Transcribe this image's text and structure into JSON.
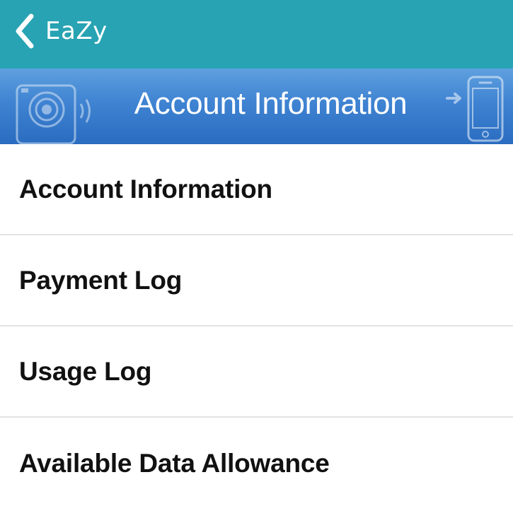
{
  "navbar": {
    "back_label": "EaZy",
    "background_color": "#27a3b3"
  },
  "banner": {
    "title": "Account Information",
    "left_icon": "camera-icon",
    "right_icon": "phone-transfer-icon"
  },
  "menu": {
    "items": [
      {
        "label": "Account Information"
      },
      {
        "label": "Payment Log"
      },
      {
        "label": "Usage Log"
      },
      {
        "label": "Available Data Allowance"
      }
    ]
  }
}
